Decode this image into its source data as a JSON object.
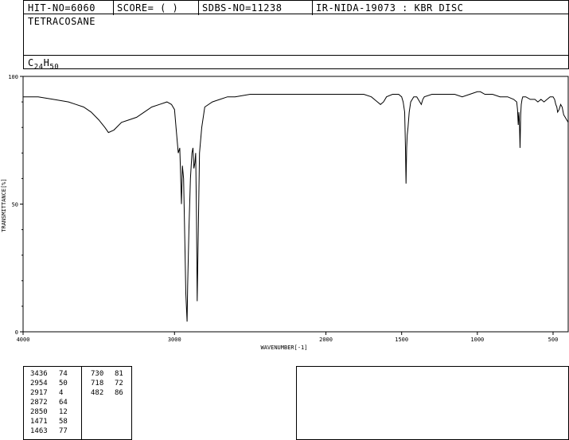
{
  "header": {
    "hit_no": "HIT-NO=6060",
    "score": "SCORE=  (   )",
    "sdbs_no": "SDBS-NO=11238",
    "ir_info": "IR-NIDA-19073 : KBR DISC"
  },
  "compound": {
    "name": "TETRACOSANE",
    "formula": {
      "C": "C",
      "c_count": "24",
      "H": "H",
      "h_count": "50"
    }
  },
  "chart_data": {
    "type": "line",
    "title": "",
    "xlabel": "WAVENUMBER[-1]",
    "ylabel": "TRANSMITTANCE[%]",
    "xlim": [
      4000,
      400
    ],
    "ylim": [
      0,
      100
    ],
    "x_ticks": [
      4000,
      3000,
      2000,
      1500,
      1000,
      500
    ],
    "x_tick_labels": [
      "4000",
      "3000",
      "2000",
      "1500",
      "1000",
      "500"
    ],
    "y_ticks": [
      0,
      50,
      100
    ],
    "y_tick_labels": [
      "0",
      "50",
      "100"
    ],
    "grid": false,
    "series": [
      {
        "x": [
          4000,
          3900,
          3800,
          3700,
          3650,
          3600,
          3550,
          3500,
          3460,
          3436,
          3400,
          3350,
          3300,
          3250,
          3200,
          3150,
          3100,
          3050,
          3020,
          3000,
          2990,
          2975,
          2965,
          2960,
          2954,
          2948,
          2940,
          2930,
          2925,
          2920,
          2917,
          2913,
          2905,
          2895,
          2885,
          2878,
          2872,
          2866,
          2860,
          2855,
          2850,
          2845,
          2835,
          2820,
          2800,
          2750,
          2700,
          2650,
          2600,
          2500,
          2400,
          2300,
          2200,
          2100,
          2000,
          1900,
          1850,
          1800,
          1750,
          1700,
          1660,
          1640,
          1620,
          1600,
          1560,
          1520,
          1500,
          1490,
          1480,
          1475,
          1471,
          1467,
          1463,
          1458,
          1450,
          1440,
          1420,
          1400,
          1380,
          1370,
          1360,
          1350,
          1300,
          1250,
          1200,
          1150,
          1100,
          1050,
          1000,
          980,
          950,
          900,
          850,
          800,
          760,
          740,
          735,
          730,
          726,
          722,
          718,
          714,
          710,
          705,
          700,
          680,
          650,
          620,
          600,
          580,
          560,
          540,
          520,
          500,
          490,
          482,
          475,
          470,
          460,
          450,
          440,
          430,
          420,
          410,
          400
        ],
        "y": [
          92,
          92,
          91,
          90,
          89,
          88,
          86,
          83,
          80,
          78,
          79,
          82,
          83,
          84,
          86,
          88,
          89,
          90,
          89,
          87,
          80,
          70,
          72,
          62,
          50,
          65,
          60,
          30,
          15,
          8,
          4,
          18,
          40,
          60,
          70,
          72,
          64,
          66,
          70,
          45,
          12,
          32,
          70,
          80,
          88,
          90,
          91,
          92,
          92,
          93,
          93,
          93,
          93,
          93,
          93,
          93,
          93,
          93,
          93,
          92,
          90,
          89,
          90,
          92,
          93,
          93,
          92,
          90,
          86,
          72,
          58,
          72,
          77,
          80,
          86,
          90,
          92,
          92,
          90,
          89,
          91,
          92,
          93,
          93,
          93,
          93,
          92,
          93,
          94,
          94,
          93,
          93,
          92,
          92,
          91,
          90,
          87,
          81,
          86,
          82,
          72,
          85,
          89,
          91,
          92,
          92,
          91,
          91,
          90,
          91,
          90,
          91,
          92,
          92,
          91,
          89,
          88,
          86,
          87,
          89,
          88,
          85,
          84,
          83,
          82
        ]
      }
    ]
  },
  "peak_table": {
    "left_columns": [
      [
        [
          "3436",
          "74"
        ],
        [
          "2954",
          "50"
        ],
        [
          "2917",
          "4"
        ],
        [
          "2872",
          "64"
        ],
        [
          "2850",
          "12"
        ],
        [
          "1471",
          "58"
        ],
        [
          "1463",
          "77"
        ]
      ],
      [
        [
          "730",
          "81"
        ],
        [
          "718",
          "72"
        ],
        [
          "482",
          "86"
        ]
      ]
    ]
  },
  "colors": {
    "line": "#000000",
    "background": "#ffffff"
  }
}
